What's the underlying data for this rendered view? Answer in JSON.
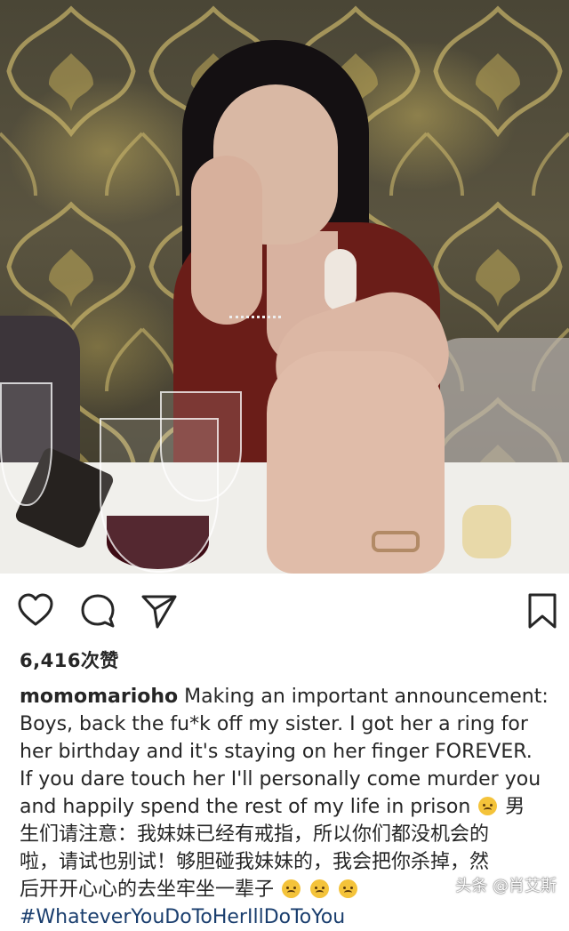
{
  "post": {
    "likes": "6,416次赞",
    "username": "momomarioho",
    "caption_lines": [
      "Making an important announcement:",
      "Boys, back the fu*k off my sister. I got her a ring for",
      "her birthday and it's staying on her finger FOREVER.",
      "If you dare touch her I'll personally come murder you",
      "and happily spend the rest of my life in prison",
      "男",
      "生们请注意：我妹妹已经有戒指，所以你们都没机会的",
      "啦，请试也别试！够胆碰我妹妹的，我会把你杀掉，然",
      "后开开心心的去坐牢坐一辈子"
    ],
    "hashtag": "#WhateverYouDoToHerIllDoToYou"
  },
  "actions": {
    "like_icon": "heart-icon",
    "comment_icon": "comment-icon",
    "share_icon": "send-icon",
    "save_icon": "bookmark-icon"
  },
  "watermark": "头条 @肖艾斯",
  "colors": {
    "text": "#262626",
    "hashtag": "#1a3e6e",
    "emoji": "#f4c33a"
  }
}
